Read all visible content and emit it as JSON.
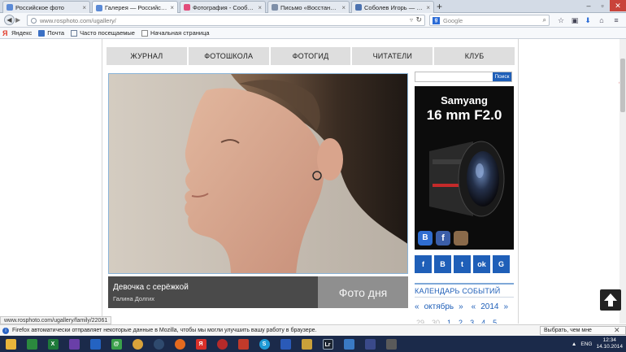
{
  "browser": {
    "tabs": [
      {
        "label": "Российское фото",
        "favicon_color": "#5b8ad6"
      },
      {
        "label": "Галерея — Российское ф...",
        "favicon_color": "#5b8ad6"
      },
      {
        "label": "Фотография - Сообществ...",
        "favicon_color": "#e24b7a"
      },
      {
        "label": "Письмо «Восстановлени...",
        "favicon_color": "#7e8fa8"
      },
      {
        "label": "Соболев Игорь — ВДНХ ...",
        "favicon_color": "#4c72b0"
      }
    ],
    "url_host": "www.rosphoto.com",
    "url_path": "/ugallery/",
    "search_placeholder": "Google",
    "bookmarks": [
      {
        "label": "Яндекс",
        "icon": "yandex-icon",
        "color": "#e23b2a"
      },
      {
        "label": "Почта",
        "icon": "mail-icon",
        "color": "#3a6fc4"
      },
      {
        "label": "Часто посещаемые",
        "icon": "frequent-icon",
        "color": "#6a7d99"
      },
      {
        "label": "Начальная страница",
        "icon": "page-icon",
        "color": "#8a8a8a"
      }
    ],
    "status_url": "www.rosphoto.com/ugallery/family/22061",
    "notification": {
      "text": "Firefox автоматически отправляет некоторые данные в Mozilla, чтобы мы могли улучшить вашу работу в браузере.",
      "button": "Выбрать, чем мне поделиться",
      "close": "✕"
    }
  },
  "site": {
    "menu": [
      "ЖУРНАЛ",
      "ФОТОШКОЛА",
      "ФОТОГИД",
      "ЧИТАТЕЛИ",
      "КЛУБ"
    ],
    "photo": {
      "title": "Девочка с серёжкой",
      "author": "Галина Долгих",
      "badge": "Фото дня"
    },
    "sidebar": {
      "search_button": "Поиск",
      "ad_brand": "Samyang",
      "ad_model": "16 mm F2.0",
      "social": [
        "f",
        "В",
        "t",
        "ok",
        "G"
      ],
      "calendar_title": "КАЛЕНДАРЬ СОБЫТИЙ",
      "calendar_prev": "«",
      "calendar_month": "октябрь",
      "calendar_next": "»",
      "calendar_prev_year": "«",
      "calendar_year": "2014",
      "calendar_next_year": "»",
      "calendar_days": [
        "29",
        "30",
        "1",
        "2",
        "3",
        "4",
        "5"
      ]
    }
  },
  "taskbar": {
    "lang": "ENG",
    "time": "12:34",
    "date": "14.10.2014"
  },
  "colors": {
    "accent": "#1f5fb8",
    "caption_dark": "#4a4a4a",
    "caption_light": "#8f8f8f"
  }
}
